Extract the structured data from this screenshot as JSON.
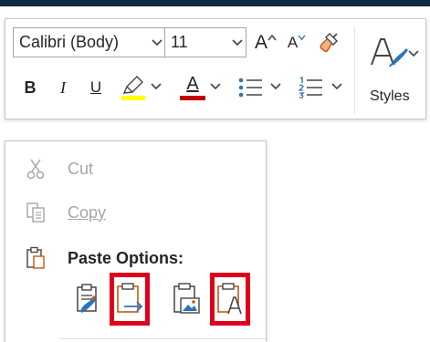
{
  "toolbar": {
    "font_name": "Calibri (Body)",
    "font_size": "11",
    "grow_font": "A",
    "shrink_font": "A",
    "bold": "B",
    "italic": "I",
    "underline": "U",
    "font_color_letter": "A",
    "styles_label": "Styles"
  },
  "colors": {
    "highlight": "#ffff00",
    "font_color": "#c00000",
    "selection_outline": "#e0001b",
    "accent_blue": "#2e75b6",
    "title_band": "#0f2b45"
  },
  "context_menu": {
    "cut": {
      "label": "Cut",
      "enabled": false,
      "icon": "scissors-icon"
    },
    "copy": {
      "label": "Copy",
      "enabled": false,
      "icon": "copy-icon"
    },
    "paste_header": {
      "label": "Paste Options:",
      "icon": "clipboard-icon"
    },
    "paste_options": [
      {
        "name": "keep-source-formatting",
        "icon": "paste-keep-source-icon",
        "highlighted": false
      },
      {
        "name": "merge-formatting",
        "icon": "paste-merge-icon",
        "highlighted": true
      },
      {
        "name": "picture",
        "icon": "paste-picture-icon",
        "highlighted": false
      },
      {
        "name": "keep-text-only",
        "icon": "paste-text-only-icon",
        "highlighted": true,
        "glyph": "A"
      }
    ]
  }
}
